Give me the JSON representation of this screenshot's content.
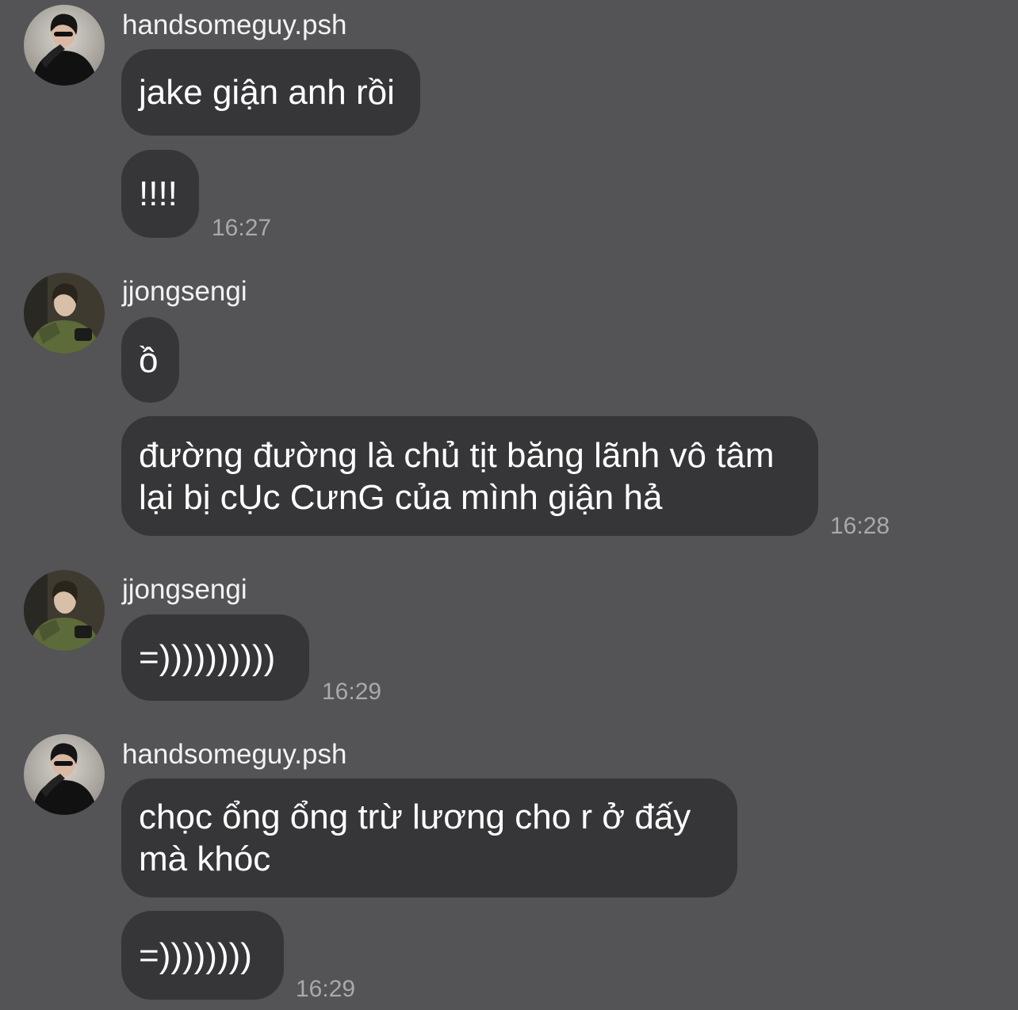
{
  "chat": {
    "messages": [
      {
        "user": "handsomeguy.psh",
        "text": [
          "jake giận anh rồi"
        ]
      },
      {
        "text": [
          "!!!!"
        ],
        "time": "16:27"
      },
      {
        "user": "jjongsengi",
        "text": [
          "ồ"
        ]
      },
      {
        "text": [
          "đường đường là chủ tịt băng lãnh vô tâm",
          "lại bị cỤc CưnG của mình giận hả"
        ],
        "time": "16:28"
      },
      {
        "user": "jjongsengi",
        "text": [
          "=))))))))))"
        ],
        "time": "16:29"
      },
      {
        "user": "handsomeguy.psh",
        "text": [
          "chọc ổng ổng trừ lương cho r ở đấy",
          "mà khóc"
        ]
      },
      {
        "text": [
          "=))))))))"
        ],
        "time": "16:29"
      }
    ]
  },
  "colors": {
    "background": "#545356",
    "bubble": "#363639",
    "username": "#f2f2f2",
    "message_text": "#ffffff",
    "timestamp": "#a9a9ac"
  }
}
